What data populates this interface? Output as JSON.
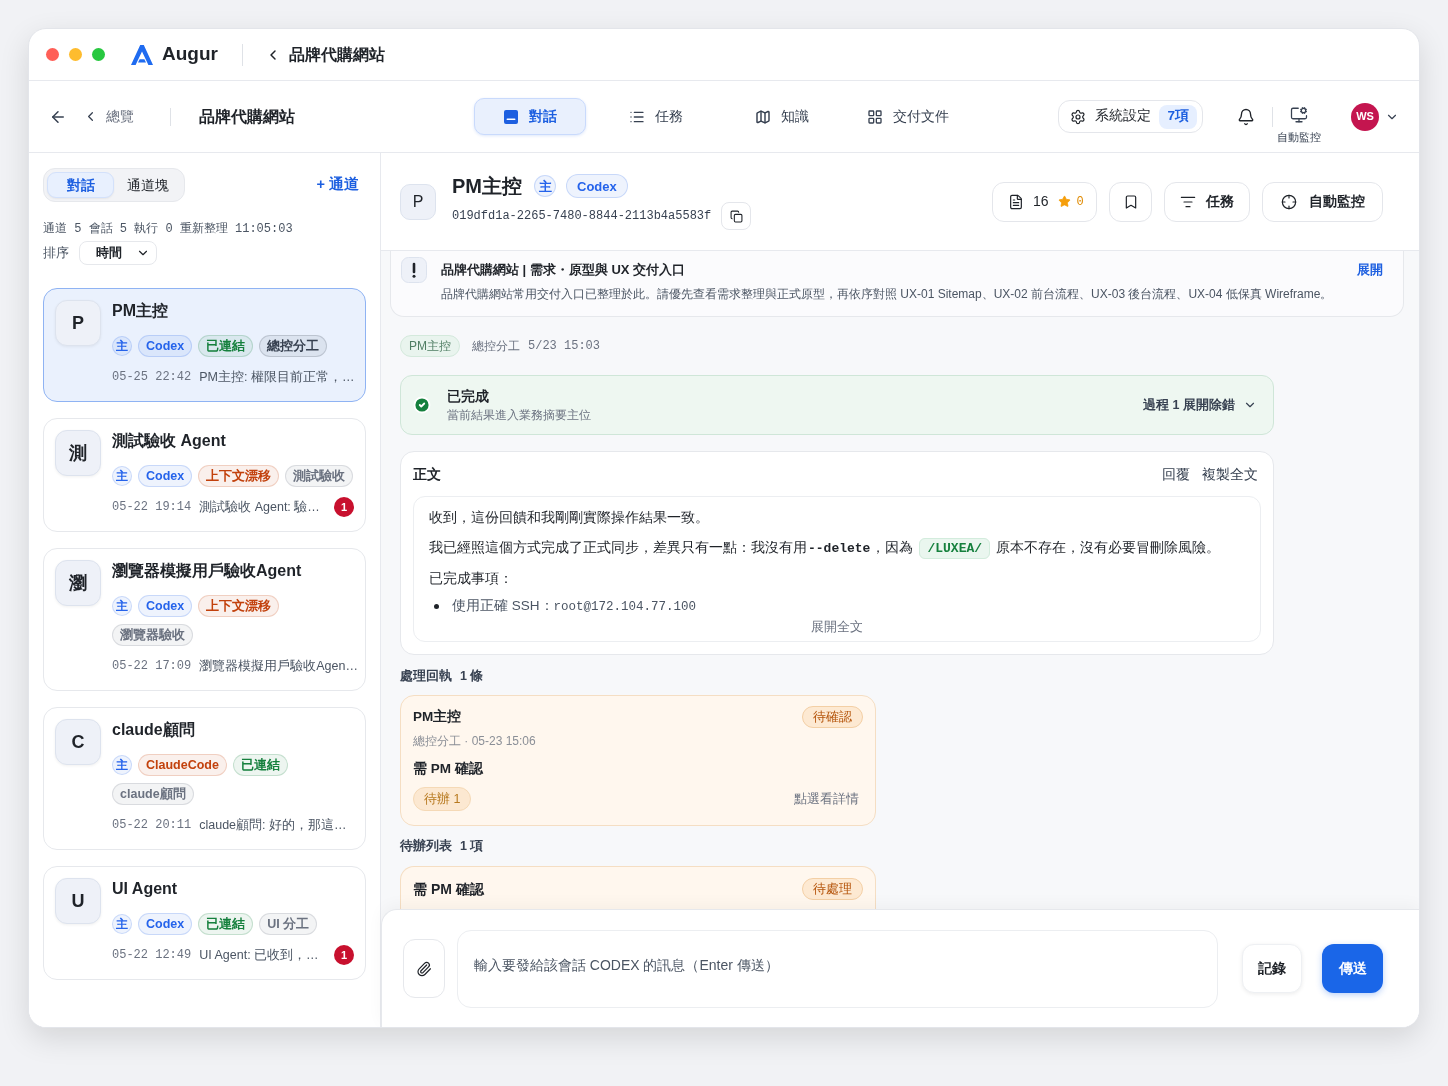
{
  "window": {
    "app_name": "Augur",
    "title": "品牌代購網站"
  },
  "nav": {
    "back_label": "總覽",
    "project": "品牌代購網站",
    "tabs": [
      {
        "label": "對話",
        "selected": true
      },
      {
        "label": "任務",
        "selected": false
      },
      {
        "label": "知識",
        "selected": false
      },
      {
        "label": "交付文件",
        "selected": false
      }
    ],
    "settings": {
      "label": "系統設定",
      "count": "7項"
    },
    "monitor_label": "自動監控",
    "avatar": "WS"
  },
  "sidebar": {
    "segments": [
      {
        "label": "對話",
        "selected": true
      },
      {
        "label": "通道塊",
        "selected": false
      }
    ],
    "add_label": "+ 通道",
    "stats": "通道 5 會話 5 執行 0 重新整理 11:05:03",
    "sort": {
      "label": "排序",
      "value": "時間"
    },
    "sessions": [
      {
        "avatar": "P",
        "title": "PM主控",
        "selected": true,
        "tags": [
          {
            "kind": "marker",
            "label": "主",
            "color": "#2563eb"
          },
          {
            "kind": "label",
            "label": "Codex",
            "color": "#2563eb"
          },
          {
            "kind": "label",
            "label": "已連結",
            "color": "#15803d"
          },
          {
            "kind": "label",
            "label": "總控分工",
            "color": "#374151"
          }
        ],
        "time": "05-25 22:42",
        "preview": "PM主控: 權限目前正常，…"
      },
      {
        "avatar": "測",
        "title": "測試驗收 Agent",
        "selected": false,
        "tags": [
          {
            "kind": "marker",
            "label": "主",
            "color": "#2563eb"
          },
          {
            "kind": "label",
            "label": "Codex",
            "color": "#2563eb"
          },
          {
            "kind": "label",
            "label": "上下文漂移",
            "color": "#c2410c"
          },
          {
            "kind": "label",
            "label": "測試驗收",
            "color": "#6b7280"
          }
        ],
        "time": "05-22 19:14",
        "preview": "測試驗收 Agent: 驗…",
        "unread": "1"
      },
      {
        "avatar": "瀏",
        "title": "瀏覽器模擬用戶驗收Agent",
        "selected": false,
        "tags": [
          {
            "kind": "marker",
            "label": "主",
            "color": "#2563eb"
          },
          {
            "kind": "label",
            "label": "Codex",
            "color": "#2563eb"
          },
          {
            "kind": "label",
            "label": "上下文漂移",
            "color": "#c2410c"
          },
          {
            "kind": "label",
            "label": "瀏覽器驗收",
            "color": "#6b7280"
          }
        ],
        "time": "05-22 17:09",
        "preview": "瀏覽器模擬用戶驗收Agen…"
      },
      {
        "avatar": "C",
        "title": "claude顧問",
        "selected": false,
        "tags": [
          {
            "kind": "marker",
            "label": "主",
            "color": "#2563eb"
          },
          {
            "kind": "label",
            "label": "ClaudeCode",
            "color": "#c2410c"
          },
          {
            "kind": "label",
            "label": "已連結",
            "color": "#15803d"
          },
          {
            "kind": "label",
            "label": "claude顧問",
            "color": "#6b7280"
          }
        ],
        "time": "05-22 20:11",
        "preview": "claude顧問: 好的，那這…"
      },
      {
        "avatar": "U",
        "title": "UI Agent",
        "selected": false,
        "tags": [
          {
            "kind": "marker",
            "label": "主",
            "color": "#2563eb"
          },
          {
            "kind": "label",
            "label": "Codex",
            "color": "#2563eb"
          },
          {
            "kind": "label",
            "label": "已連結",
            "color": "#15803d"
          },
          {
            "kind": "label",
            "label": "UI 分工",
            "color": "#6b7280"
          }
        ],
        "time": "05-22 12:49",
        "preview": "UI Agent: 已收到，…",
        "unread": "1"
      }
    ]
  },
  "conversation": {
    "avatar": "P",
    "title": "PM主控",
    "tags": [
      {
        "kind": "marker",
        "label": "主",
        "color": "#2563eb"
      },
      {
        "kind": "label",
        "label": "Codex",
        "color": "#2563eb"
      }
    ],
    "id": "019dfd1a-2265-7480-8844-2113b4a5583f",
    "doc_count": "16",
    "star_count": "0",
    "task_button": "任務",
    "monitor_button": "自動監控"
  },
  "notice": {
    "title": "品牌代購網站 | 需求・原型與 UX 交付入口",
    "action": "展開",
    "text": "品牌代購網站常用交付入口已整理於此。請優先查看需求整理與正式原型，再依序對照 UX-01 Sitemap、UX-02 前台流程、UX-03 後台流程、UX-04 低保真 Wireframe。"
  },
  "message": {
    "sender": "PM主控",
    "role": "總控分工",
    "time": "5/23 15:03",
    "status": {
      "done": true,
      "title": "已完成",
      "subtitle": "當前結果進入業務摘要主位",
      "action": "過程 1 展開除錯"
    },
    "body": {
      "title": "正文",
      "actions": [
        "回覆",
        "複製全文"
      ],
      "paragraphs": [
        [
          {
            "kind": "text",
            "text": "收到，這份回饋和我剛剛實際操作結果一致。"
          }
        ],
        [
          {
            "kind": "text",
            "text": "我已經照這個方式完成了正式同步，差異只有一點：我沒有用"
          },
          {
            "kind": "code",
            "text": "--delete"
          },
          {
            "kind": "text",
            "text": "，因為"
          },
          {
            "kind": "chip",
            "text": "/LUXEA/"
          },
          {
            "kind": "text",
            "text": "原本不存在，沒有必要冒刪除風險。"
          }
        ],
        [
          {
            "kind": "text",
            "text": "已完成事項："
          }
        ]
      ],
      "bullets": [
        [
          {
            "kind": "text",
            "text": "使用正確 SSH："
          },
          {
            "kind": "mono",
            "text": "root@172.104.77.100"
          }
        ]
      ],
      "expand": "展開全文"
    }
  },
  "receipts": {
    "label": "處理回執",
    "count": "1 條",
    "items": [
      {
        "sender": "PM主控",
        "status": "待確認",
        "meta": "總控分工 · 05-23 15:06",
        "title": "需 PM 確認",
        "pending": "待辦 1",
        "link": "點選看詳情"
      }
    ]
  },
  "todos": {
    "label": "待辦列表",
    "count": "1 項",
    "items": [
      {
        "title": "需 PM 確認",
        "status": "待處理"
      }
    ]
  },
  "composer": {
    "placeholder": "輸入要發給該會話 CODEX 的訊息（Enter 傳送）",
    "log_button": "記錄",
    "send_button": "傳送"
  }
}
